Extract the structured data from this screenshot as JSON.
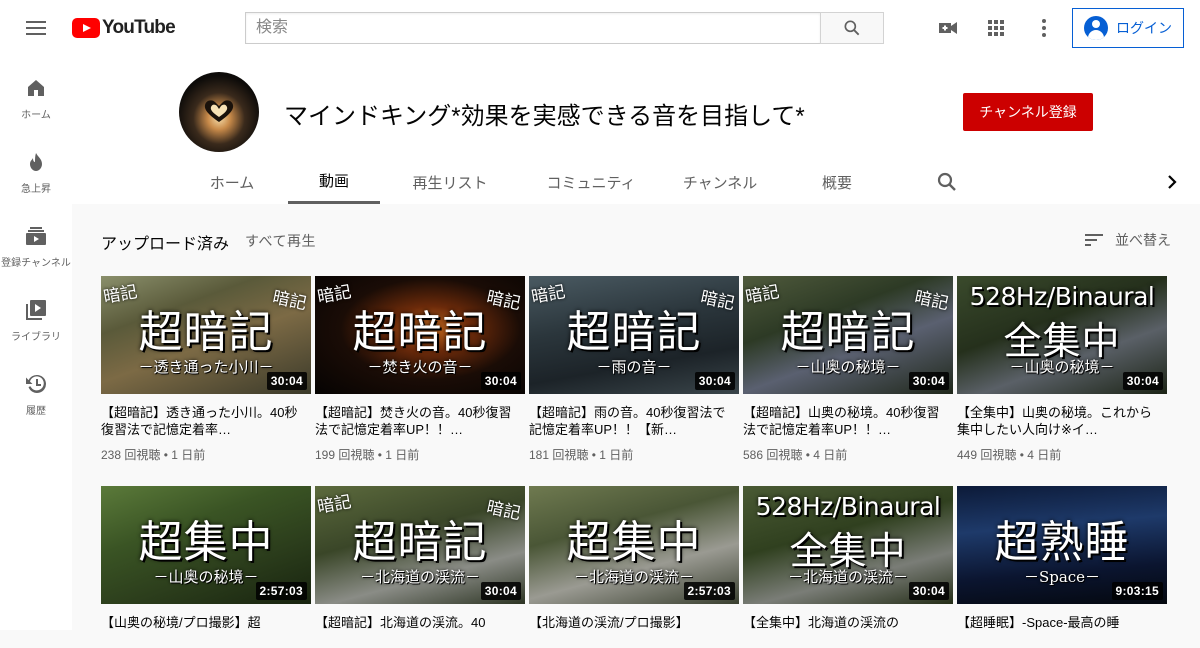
{
  "header": {
    "logo_text": "YouTube",
    "search_placeholder": "検索",
    "login_label": "ログイン"
  },
  "sidebar": {
    "items": [
      {
        "label": "ホーム",
        "icon": "home-icon"
      },
      {
        "label": "急上昇",
        "icon": "trending-icon"
      },
      {
        "label": "登録チャンネル",
        "icon": "subscriptions-icon"
      },
      {
        "label": "ライブラリ",
        "icon": "library-icon"
      },
      {
        "label": "履歴",
        "icon": "history-icon"
      }
    ]
  },
  "channel": {
    "name": "マインドキング*効果を実感できる音を目指して*",
    "subscribe_label": "チャンネル登録",
    "tabs": [
      "ホーム",
      "動画",
      "再生リスト",
      "コミュニティ",
      "チャンネル",
      "概要"
    ],
    "active_tab": "動画"
  },
  "section": {
    "title": "アップロード済み",
    "play_all": "すべて再生",
    "sort_label": "並べ替え"
  },
  "colors": {
    "accent_red": "#cc0000",
    "link_blue": "#065fd4",
    "youtube_red": "#ff0000"
  },
  "videos": [
    {
      "big": "超暗記",
      "tag": "暗記",
      "sub": "－透き通った小川－",
      "duration": "30:04",
      "title": "【超暗記】透き通った小川。40秒復習法で記憶定着率…",
      "meta": "238 回視聴 • 1 日前"
    },
    {
      "big": "超暗記",
      "tag": "暗記",
      "sub": "－焚き火の音－",
      "duration": "30:04",
      "title": "【超暗記】焚き火の音。40秒復習法で記憶定着率UP！！…",
      "meta": "199 回視聴 • 1 日前"
    },
    {
      "big": "超暗記",
      "tag": "暗記",
      "sub": "－雨の音－",
      "duration": "30:04",
      "title": "【超暗記】雨の音。40秒復習法で記憶定着率UP！！【新…",
      "meta": "181 回視聴 • 1 日前"
    },
    {
      "big": "超暗記",
      "tag": "暗記",
      "sub": "－山奥の秘境－",
      "duration": "30:04",
      "title": "【超暗記】山奥の秘境。40秒復習法で記憶定着率UP！！…",
      "meta": "586 回視聴 • 4 日前"
    },
    {
      "big_en": "528Hz/Binaural",
      "big": "全集中",
      "sub": "－山奥の秘境－",
      "duration": "30:04",
      "title": "【全集中】山奥の秘境。これから集中したい人向け※イ…",
      "meta": "449 回視聴 • 4 日前"
    },
    {
      "big": "超集中",
      "sub": "－山奥の秘境－",
      "duration": "2:57:03",
      "title": "【山奥の秘境/プロ撮影】超",
      "meta": ""
    },
    {
      "big": "超暗記",
      "tag": "暗記",
      "sub": "－北海道の渓流－",
      "duration": "30:04",
      "title": "【超暗記】北海道の渓流。40",
      "meta": ""
    },
    {
      "big": "超集中",
      "sub": "－北海道の渓流－",
      "duration": "2:57:03",
      "title": "【北海道の渓流/プロ撮影】",
      "meta": ""
    },
    {
      "big_en": "528Hz/Binaural",
      "big": "全集中",
      "sub": "－北海道の渓流－",
      "duration": "30:04",
      "title": "【全集中】北海道の渓流の",
      "meta": ""
    },
    {
      "big": "超熟睡",
      "sub": "－Space－",
      "duration": "9:03:15",
      "title": "【超睡眠】-Space-最高の睡",
      "meta": ""
    }
  ]
}
